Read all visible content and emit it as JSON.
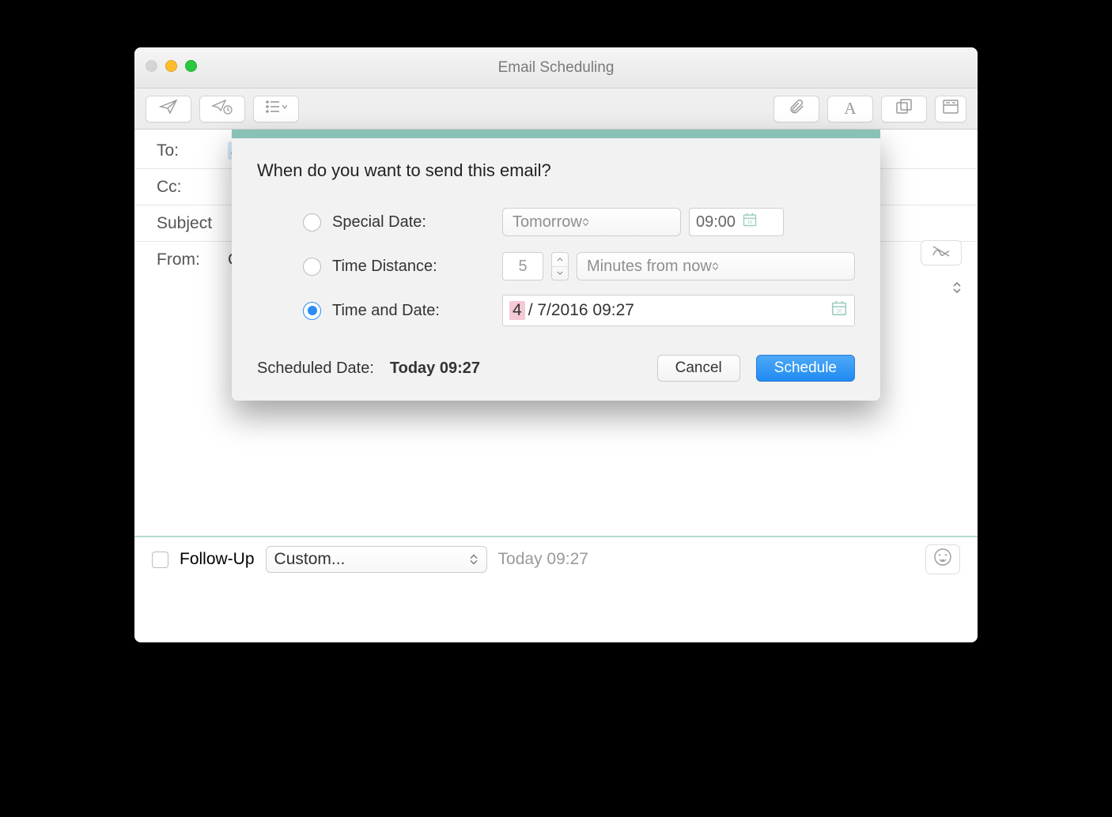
{
  "window": {
    "title": "Email Scheduling"
  },
  "compose": {
    "to_label": "To:",
    "to_value": "Jo",
    "cc_label": "Cc:",
    "subject_label": "Subject",
    "from_label": "From:",
    "from_value_partial": "C"
  },
  "footer": {
    "followup_label": "Follow-Up",
    "followup_select": "Custom...",
    "time_text": "Today 09:27"
  },
  "modal": {
    "heading": "When do you want to send this email?",
    "option_special": "Special Date:",
    "option_distance": "Time Distance:",
    "option_timedate": "Time and Date:",
    "selected_option": "timedate",
    "special_select": "Tomorrow",
    "special_time": "09:00",
    "distance_value": "5",
    "distance_unit": "Minutes from now",
    "datetime_highlight": "4",
    "datetime_rest": "/  7/2016 09:27",
    "scheduled_label": "Scheduled Date:",
    "scheduled_value": "Today 09:27",
    "cancel": "Cancel",
    "schedule": "Schedule"
  }
}
